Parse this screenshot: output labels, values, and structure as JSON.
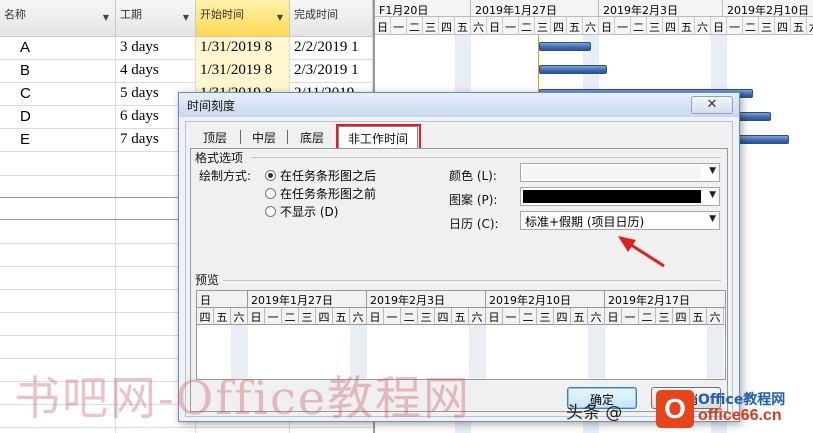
{
  "table": {
    "headers": [
      "名称",
      "工期",
      "开始时间",
      "完成时间"
    ],
    "rows": [
      {
        "name": "A",
        "duration": "3 days",
        "start": "1/31/2019 8",
        "finish": "2/2/2019 1"
      },
      {
        "name": "B",
        "duration": "4 days",
        "start": "1/31/2019 8",
        "finish": "2/3/2019 1"
      },
      {
        "name": "C",
        "duration": "5 days",
        "start": "1/31/2019 8",
        "finish": "2/11/2019"
      },
      {
        "name": "D",
        "duration": "6 days",
        "start": "",
        "finish": ""
      },
      {
        "name": "E",
        "duration": "7 days",
        "start": "",
        "finish": ""
      }
    ]
  },
  "gantt": {
    "weeks": [
      "F1月20日",
      "2019年1月27日",
      "2019年2月3日",
      "2019年2月10日"
    ],
    "days": [
      "日",
      "一",
      "二",
      "三",
      "四",
      "五",
      "六",
      "日",
      "一",
      "二",
      "三",
      "四",
      "五",
      "六",
      "日",
      "一",
      "二",
      "三",
      "四",
      "五",
      "六",
      "日",
      "一",
      "二",
      "三",
      "四",
      "五",
      "六"
    ],
    "extra_day": "五"
  },
  "dialog": {
    "title": "时间刻度",
    "close_label": "✕",
    "tabs": [
      "顶层",
      "中层",
      "底层",
      "非工作时间"
    ],
    "active_tab": "非工作时间",
    "format_group_label": "格式选项",
    "draw_label": "绘制方式:",
    "draw_options": [
      "在任务条形图之后",
      "在任务条形图之前",
      "不显示 (D)"
    ],
    "draw_selected": "在任务条形图之后",
    "color_label": "颜色 (L):",
    "pattern_label": "图案 (P):",
    "calendar_label": "日历 (C):",
    "calendar_value": "标准+假期 (项目日历)",
    "preview_label": "预览",
    "preview_weeks": [
      "日",
      "2019年1月27日",
      "2019年2月3日",
      "2019年2月10日",
      "2019年2月17日"
    ],
    "preview_days": [
      "四",
      "五",
      "六",
      "日",
      "一",
      "二",
      "三",
      "四",
      "五",
      "六",
      "日",
      "一",
      "二",
      "三",
      "四",
      "五",
      "六",
      "日",
      "一",
      "二",
      "三",
      "四",
      "五",
      "六",
      "日",
      "一",
      "二",
      "三",
      "四",
      "五",
      "六"
    ],
    "ok_label": "确定",
    "cancel_label": "取消"
  },
  "watermarks": {
    "site_text": "书吧网-Office教程网",
    "toutiao_text": "头条 @",
    "logo_letter": "O",
    "logo_line1": "Office教程网",
    "logo_line2": "office66.cn"
  },
  "colors": {
    "highlight_red": "#e02020",
    "gantt_bar": "#3f6ab0",
    "selected_header": "#ffd955"
  }
}
